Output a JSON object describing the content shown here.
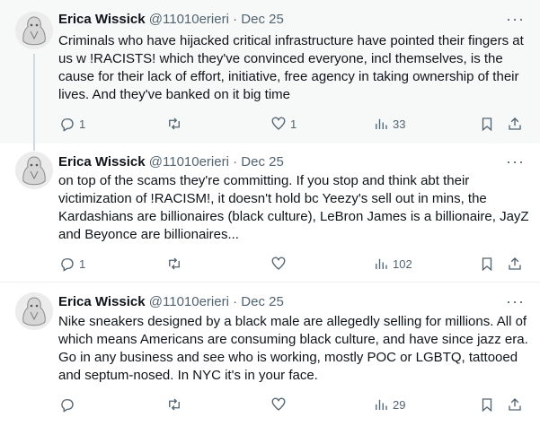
{
  "tweets": [
    {
      "name": "Erica Wissick",
      "handle": "@11010erieri",
      "sep": "·",
      "date": "Dec 25",
      "more": "···",
      "text": "Criminals who have hijacked critical infrastructure have pointed their fingers at us w !RACISTS! which they've convinced everyone, incl themselves, is the cause for their lack of effort, initiative, free agency in taking ownership of their lives. And they've banked on it big time",
      "replies": "1",
      "retweets": "",
      "likes": "1",
      "views": "33"
    },
    {
      "name": "Erica Wissick",
      "handle": "@11010erieri",
      "sep": "·",
      "date": "Dec 25",
      "more": "···",
      "text": "on top of the scams they're committing. If you stop and think abt their victimization of !RACISM!, it doesn't hold bc Yeezy's sell out in mins, the Kardashians are billionaires (black culture), LeBron James is a billionaire, JayZ and Beyonce are billionaires...",
      "replies": "1",
      "retweets": "",
      "likes": "",
      "views": "102"
    },
    {
      "name": "Erica Wissick",
      "handle": "@11010erieri",
      "sep": "·",
      "date": "Dec 25",
      "more": "···",
      "text": "Nike sneakers designed by a black male are allegedly selling for millions. All of which means Americans are consuming black culture, and have since jazz era. Go in any business and see who is working, mostly POC or LGBTQ, tattooed and septum-nosed. In NYC it's in your face.",
      "replies": "",
      "retweets": "",
      "likes": "",
      "views": "29"
    }
  ],
  "icons": [
    "reply-icon",
    "retweet-icon",
    "like-icon",
    "views-icon",
    "bookmark-icon",
    "share-icon"
  ],
  "colors": {
    "text": "#0f1419",
    "secondary": "#536471",
    "highlight_bg": "#f7f9f9",
    "thread_line": "#cfd9de"
  }
}
